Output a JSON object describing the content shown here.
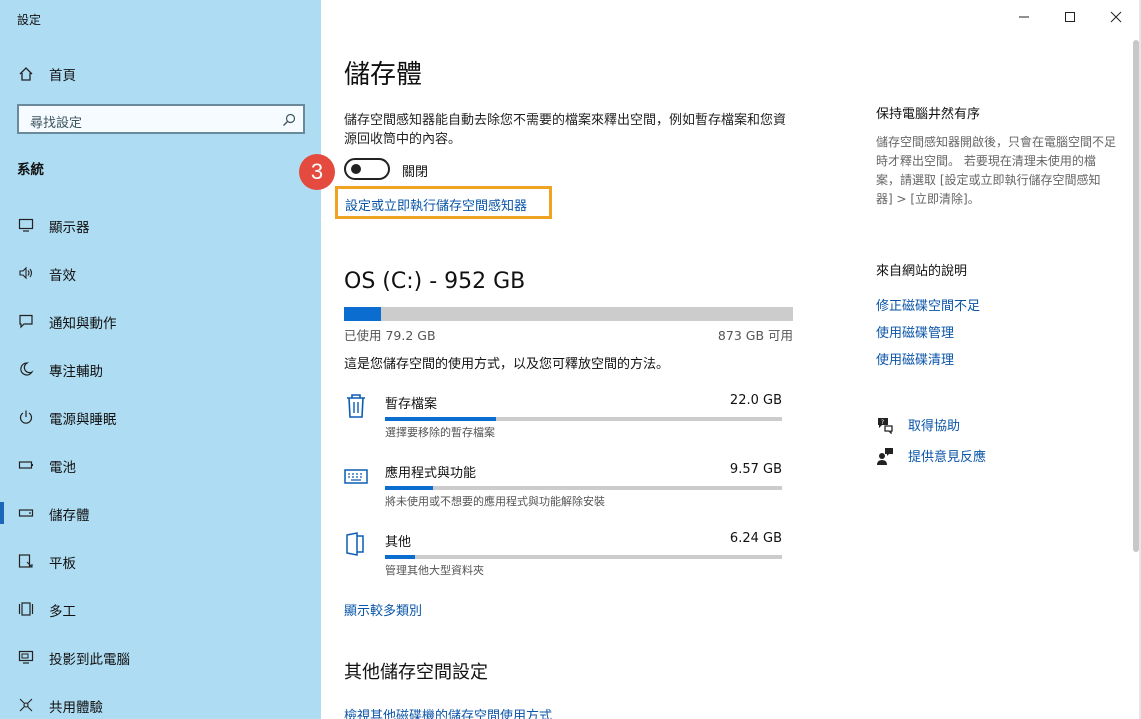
{
  "window": {
    "title": "設定"
  },
  "titlebar": {
    "minimize_icon": "minimize-icon",
    "maximize_icon": "maximize-icon",
    "close_icon": "close-icon"
  },
  "sidebar": {
    "home_label": "首頁",
    "search_placeholder": "尋找設定",
    "section": "系統",
    "active_index": 6,
    "items": [
      {
        "label": "顯示器",
        "icon": "monitor-icon"
      },
      {
        "label": "音效",
        "icon": "speaker-icon"
      },
      {
        "label": "通知與動作",
        "icon": "message-icon"
      },
      {
        "label": "專注輔助",
        "icon": "moon-icon"
      },
      {
        "label": "電源與睡眠",
        "icon": "power-icon"
      },
      {
        "label": "電池",
        "icon": "battery-icon"
      },
      {
        "label": "儲存體",
        "icon": "storage-icon"
      },
      {
        "label": "平板",
        "icon": "tablet-icon"
      },
      {
        "label": "多工",
        "icon": "multitask-icon"
      },
      {
        "label": "投影到此電腦",
        "icon": "project-icon"
      },
      {
        "label": "共用體驗",
        "icon": "share-icon"
      }
    ]
  },
  "main": {
    "title": "儲存體",
    "storage_sense": {
      "description": "儲存空間感知器能自動去除您不需要的檔案來釋出空間，例如暫存檔案和您資源回收筒中的內容。",
      "toggle_state": "關閉",
      "toggle_on": false,
      "configure_link": "設定或立即執行儲存空間感知器",
      "step_number": "3",
      "step_color": "#e44a3e",
      "highlight_color": "#f0a321"
    },
    "drive": {
      "title": "OS (C:) - 952 GB",
      "used": "已使用 79.2 GB",
      "free": "873 GB 可用",
      "used_fraction": 0.083
    },
    "usage_description": "這是您儲存空間的使用方式，以及您可釋放空間的方法。",
    "categories": [
      {
        "name": "暫存檔案",
        "size": "22.0 GB",
        "sub": "選擇要移除的暫存檔案",
        "fraction": 0.28,
        "icon": "trash-icon"
      },
      {
        "name": "應用程式與功能",
        "size": "9.57 GB",
        "sub": "將未使用或不想要的應用程式與功能解除安裝",
        "fraction": 0.12,
        "icon": "keyboard-icon"
      },
      {
        "name": "其他",
        "size": "6.24 GB",
        "sub": "管理其他大型資料夾",
        "fraction": 0.075,
        "icon": "folder-icon"
      }
    ],
    "more_categories": "顯示較多類別",
    "other_settings_title": "其他儲存空間設定",
    "view_other_link": "檢視其他磁碟機的儲存空間使用方式"
  },
  "right": {
    "tidy_heading": "保持電腦井然有序",
    "tidy_text": "儲存空間感知器開啟後，只會在電腦空間不足時才釋出空間。 若要現在清理未使用的檔案，請選取 [設定或立即執行儲存空間感知器] > [立即清除]。",
    "web_heading": "來自網站的說明",
    "web_links": [
      "修正磁碟空間不足",
      "使用磁碟管理",
      "使用磁碟清理"
    ],
    "help_link": "取得協助",
    "feedback_link": "提供意見反應"
  },
  "colors": {
    "sidebar_bg": "#aedcf2",
    "accent": "#0b6dd0",
    "link": "#0a55a8"
  }
}
